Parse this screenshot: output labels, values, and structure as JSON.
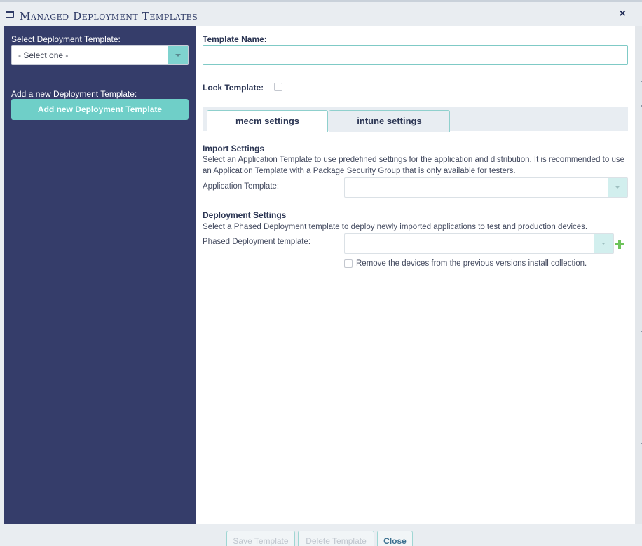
{
  "window": {
    "title": "Managed Deployment Templates",
    "close_label": "×"
  },
  "sidebar": {
    "select_label": "Select Deployment Template:",
    "select_value": "- Select one -",
    "add_label": "Add a new Deployment Template:",
    "add_button": "Add new Deployment Template"
  },
  "main": {
    "template_name_label": "Template Name:",
    "template_name_value": "",
    "lock_label": "Lock Template:",
    "lock_checked": false,
    "tabs": [
      {
        "label": "mecm settings",
        "active": true
      },
      {
        "label": "intune settings",
        "active": false
      }
    ],
    "import": {
      "title": "Import Settings",
      "description": "Select an Application Template to use predefined settings for the application and distribution. It is recommended to use an Application Template with a Package Security Group that is only available for testers.",
      "field_label": "Application Template:",
      "field_value": ""
    },
    "deployment": {
      "title": "Deployment Settings",
      "description": "Select a Phased Deployment template to deploy newly imported applications to test and production devices.",
      "field_label": "Phased Deployment template:",
      "field_value": "",
      "remove_label": "Remove the devices from the previous versions install collection.",
      "remove_checked": false
    }
  },
  "footer": {
    "save": "Save Template",
    "delete": "Delete Template",
    "close": "Close"
  },
  "colors": {
    "sidebar_bg": "#353d6a",
    "accent_teal": "#6fcfc8",
    "plus_green": "#6dc35a"
  }
}
